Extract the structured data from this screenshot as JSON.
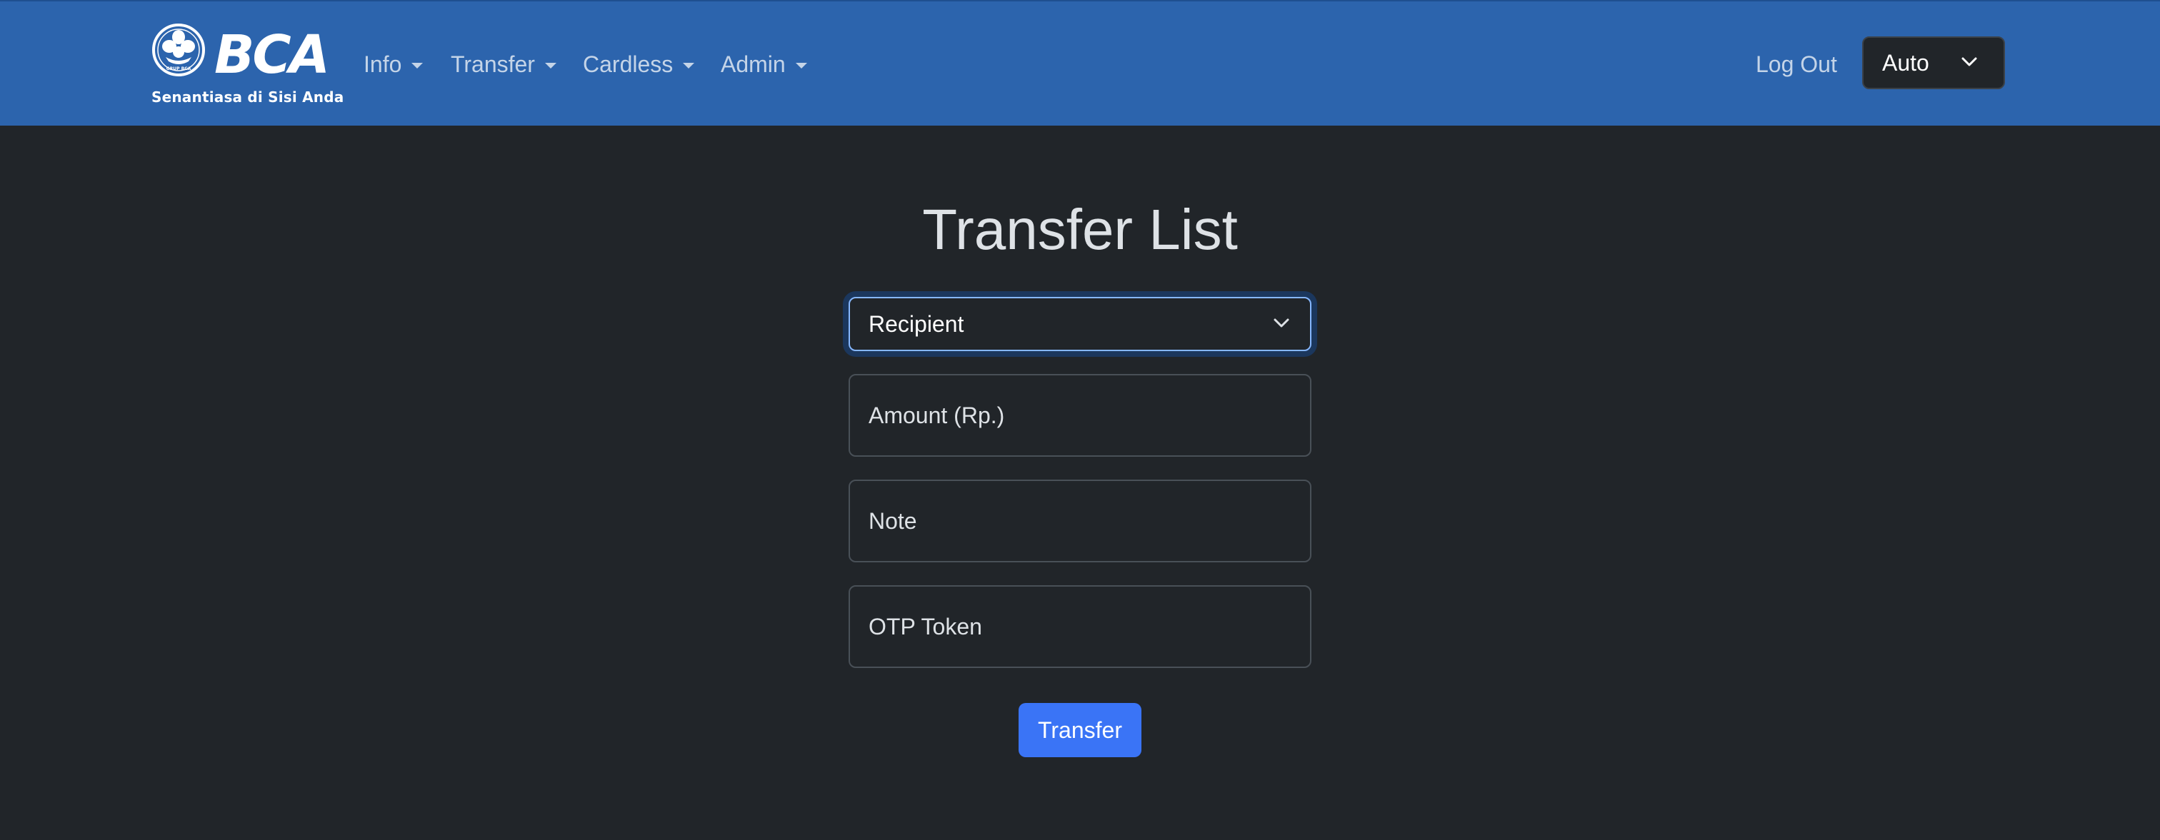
{
  "brand": {
    "logo_text": "BCA",
    "emblem_text": "GRUP BCA",
    "tagline": "Senantiasa di Sisi Anda"
  },
  "nav": {
    "items": [
      {
        "label": "Info"
      },
      {
        "label": "Transfer"
      },
      {
        "label": "Cardless"
      },
      {
        "label": "Admin"
      }
    ],
    "logout_label": "Log Out",
    "theme_select": {
      "value": "Auto"
    }
  },
  "main": {
    "title": "Transfer List",
    "recipient_select": {
      "value": "Recipient"
    },
    "amount_field": {
      "placeholder": "Amount (Rp.)"
    },
    "note_field": {
      "placeholder": "Note"
    },
    "otp_field": {
      "placeholder": "OTP Token"
    },
    "submit_label": "Transfer"
  },
  "colors": {
    "navbar": "#2c64ad",
    "background": "#212529",
    "primary_button": "#3a74f6",
    "focus_border": "#86b7fe"
  },
  "icons": {
    "theme_select_arrow": "chevron-down-icon",
    "recipient_select_arrow": "chevron-down-icon",
    "dropdown_caret": "caret-down-icon",
    "brand_emblem": "bca-emblem-icon"
  }
}
